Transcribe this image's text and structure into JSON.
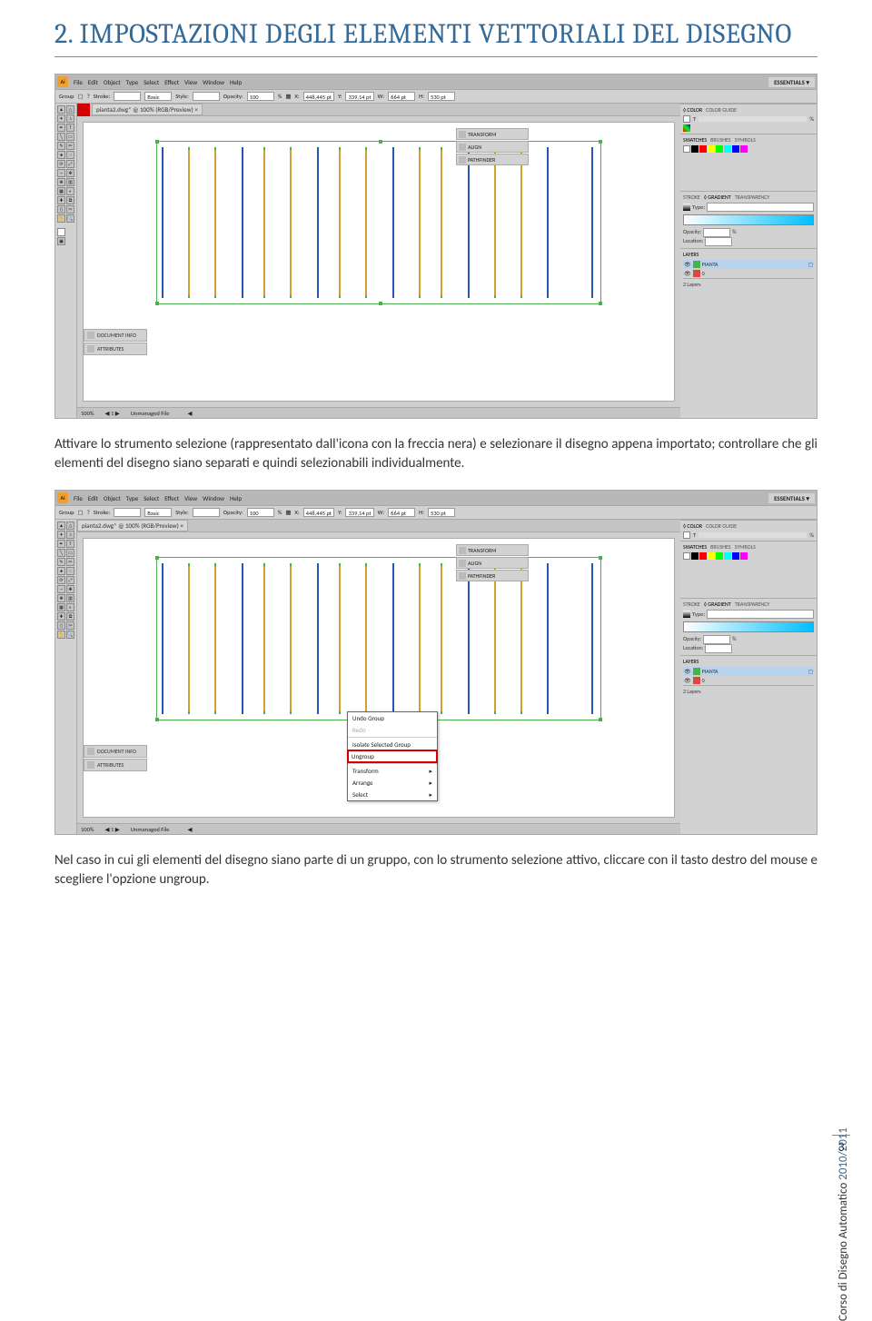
{
  "heading": "2. IMPOSTAZIONI DEGLI ELEMENTI VETTORIALI DEL DISEGNO",
  "menubar": {
    "items": [
      "File",
      "Edit",
      "Object",
      "Type",
      "Select",
      "Effect",
      "View",
      "Window",
      "Help"
    ],
    "workspace": "ESSENTIALS ▾"
  },
  "optionbar": {
    "group": "Group",
    "stroke_label": "Stroke:",
    "brush": "Basic",
    "style_label": "Style:",
    "opacity_label": "Opacity:",
    "opacity_value": "100",
    "percent": "%",
    "x_label": "X:",
    "x_value": "448,445 pt",
    "y_label": "Y:",
    "y_value": "339,14 pt",
    "w_label": "W:",
    "w_value": "664 pt",
    "h_label": "H:",
    "h_value": "530 pt"
  },
  "doc_tab": "pianta2.dwg* @ 100% (RGB/Preview)  ×",
  "floating_panels": {
    "transform": "TRANSFORM",
    "align": "ALIGN",
    "pathfinder": "PATHFINDER"
  },
  "right_panels": {
    "color": {
      "tabs": [
        "◊ COLOR",
        "COLOR GUIDE"
      ],
      "t_label": "T",
      "pct": "%"
    },
    "swatches": {
      "tabs": [
        "SWATCHES",
        "BRUSHES",
        "SYMBOLS"
      ]
    },
    "stroke": {
      "tabs": [
        "STROKE",
        "◊ GRADIENT",
        "TRANSPARENCY"
      ],
      "type_label": "Type:"
    },
    "appearance": {
      "opacity_label": "Opacity:",
      "opacity_val": "%",
      "location_label": "Location:"
    },
    "layers": {
      "tab": "LAYERS",
      "items": [
        "PIANTA",
        "0"
      ],
      "footer": "2 Layers"
    }
  },
  "left_extra": {
    "doc_info": "DOCUMENT INFO",
    "attributes": "ATTRIBUTES"
  },
  "statusbar": {
    "zoom": "100%",
    "file_status": "Unmanaged File"
  },
  "paragraph1": "Attivare lo strumento selezione (rappresentato dall'icona con la freccia nera) e selezionare il disegno appena importato; controllare che gli elementi del disegno siano separati e quindi selezionabili individualmente.",
  "paragraph2": "Nel caso in cui gli elementi del disegno siano parte di un gruppo, con lo strumento selezione attivo, cliccare con il tasto destro del mouse e scegliere l'opzione ungroup.",
  "context_menu": {
    "undo": "Undo Group",
    "redo": "Redo",
    "isolate": "Isolate Selected Group",
    "ungroup": "Ungroup",
    "transform": "Transform",
    "arrange": "Arrange",
    "select": "Select"
  },
  "footer": {
    "course": "Corso di Disegno Automatico",
    "year": " 2010/2011",
    "page": "3"
  }
}
